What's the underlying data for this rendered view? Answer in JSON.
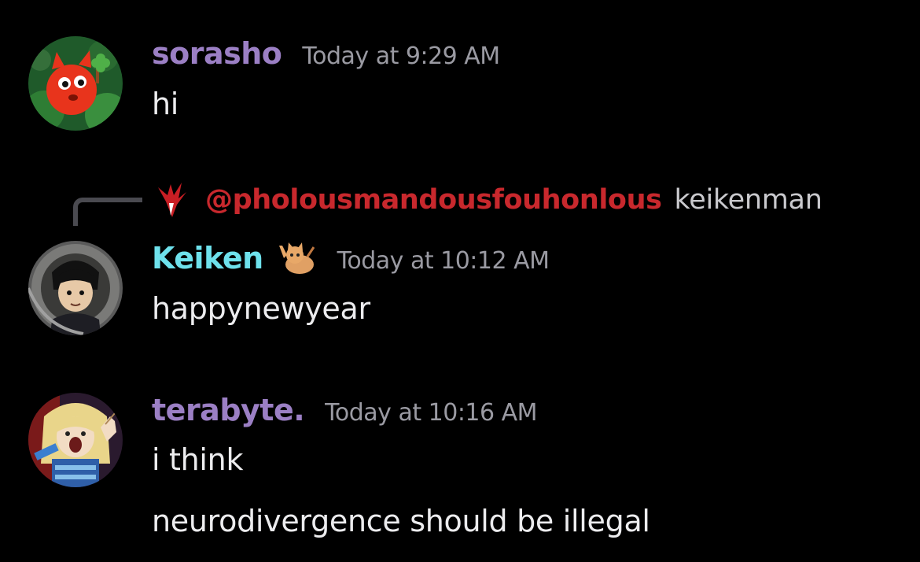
{
  "messages": [
    {
      "username": "sorasho",
      "username_color": "#9b7fc4",
      "timestamp": "Today at 9:29 AM",
      "lines": [
        "hi"
      ]
    },
    {
      "reply": {
        "mention": "@pholousmandousfouhonlous",
        "mention_color": "#c8282d",
        "snippet": "keikenman"
      },
      "username": "Keiken",
      "username_color": "#6ee1ec",
      "timestamp": "Today at 10:12 AM",
      "lines": [
        "happynewyear"
      ]
    },
    {
      "username": "terabyte.",
      "username_color": "#9b7fc4",
      "timestamp": "Today at 10:16 AM",
      "lines": [
        "i think",
        "neurodivergence should be illegal"
      ]
    }
  ],
  "icons": {
    "sorasho_avatar": "avatar-red-creature-icon",
    "keiken_avatar": "avatar-anime-boy-icon",
    "terabyte_avatar": "avatar-anime-girl-icon",
    "reply_avatar": "red-bird-icon",
    "keiken_badge": "cat-emoji-icon",
    "reply_connector": "reply-connector-icon"
  }
}
